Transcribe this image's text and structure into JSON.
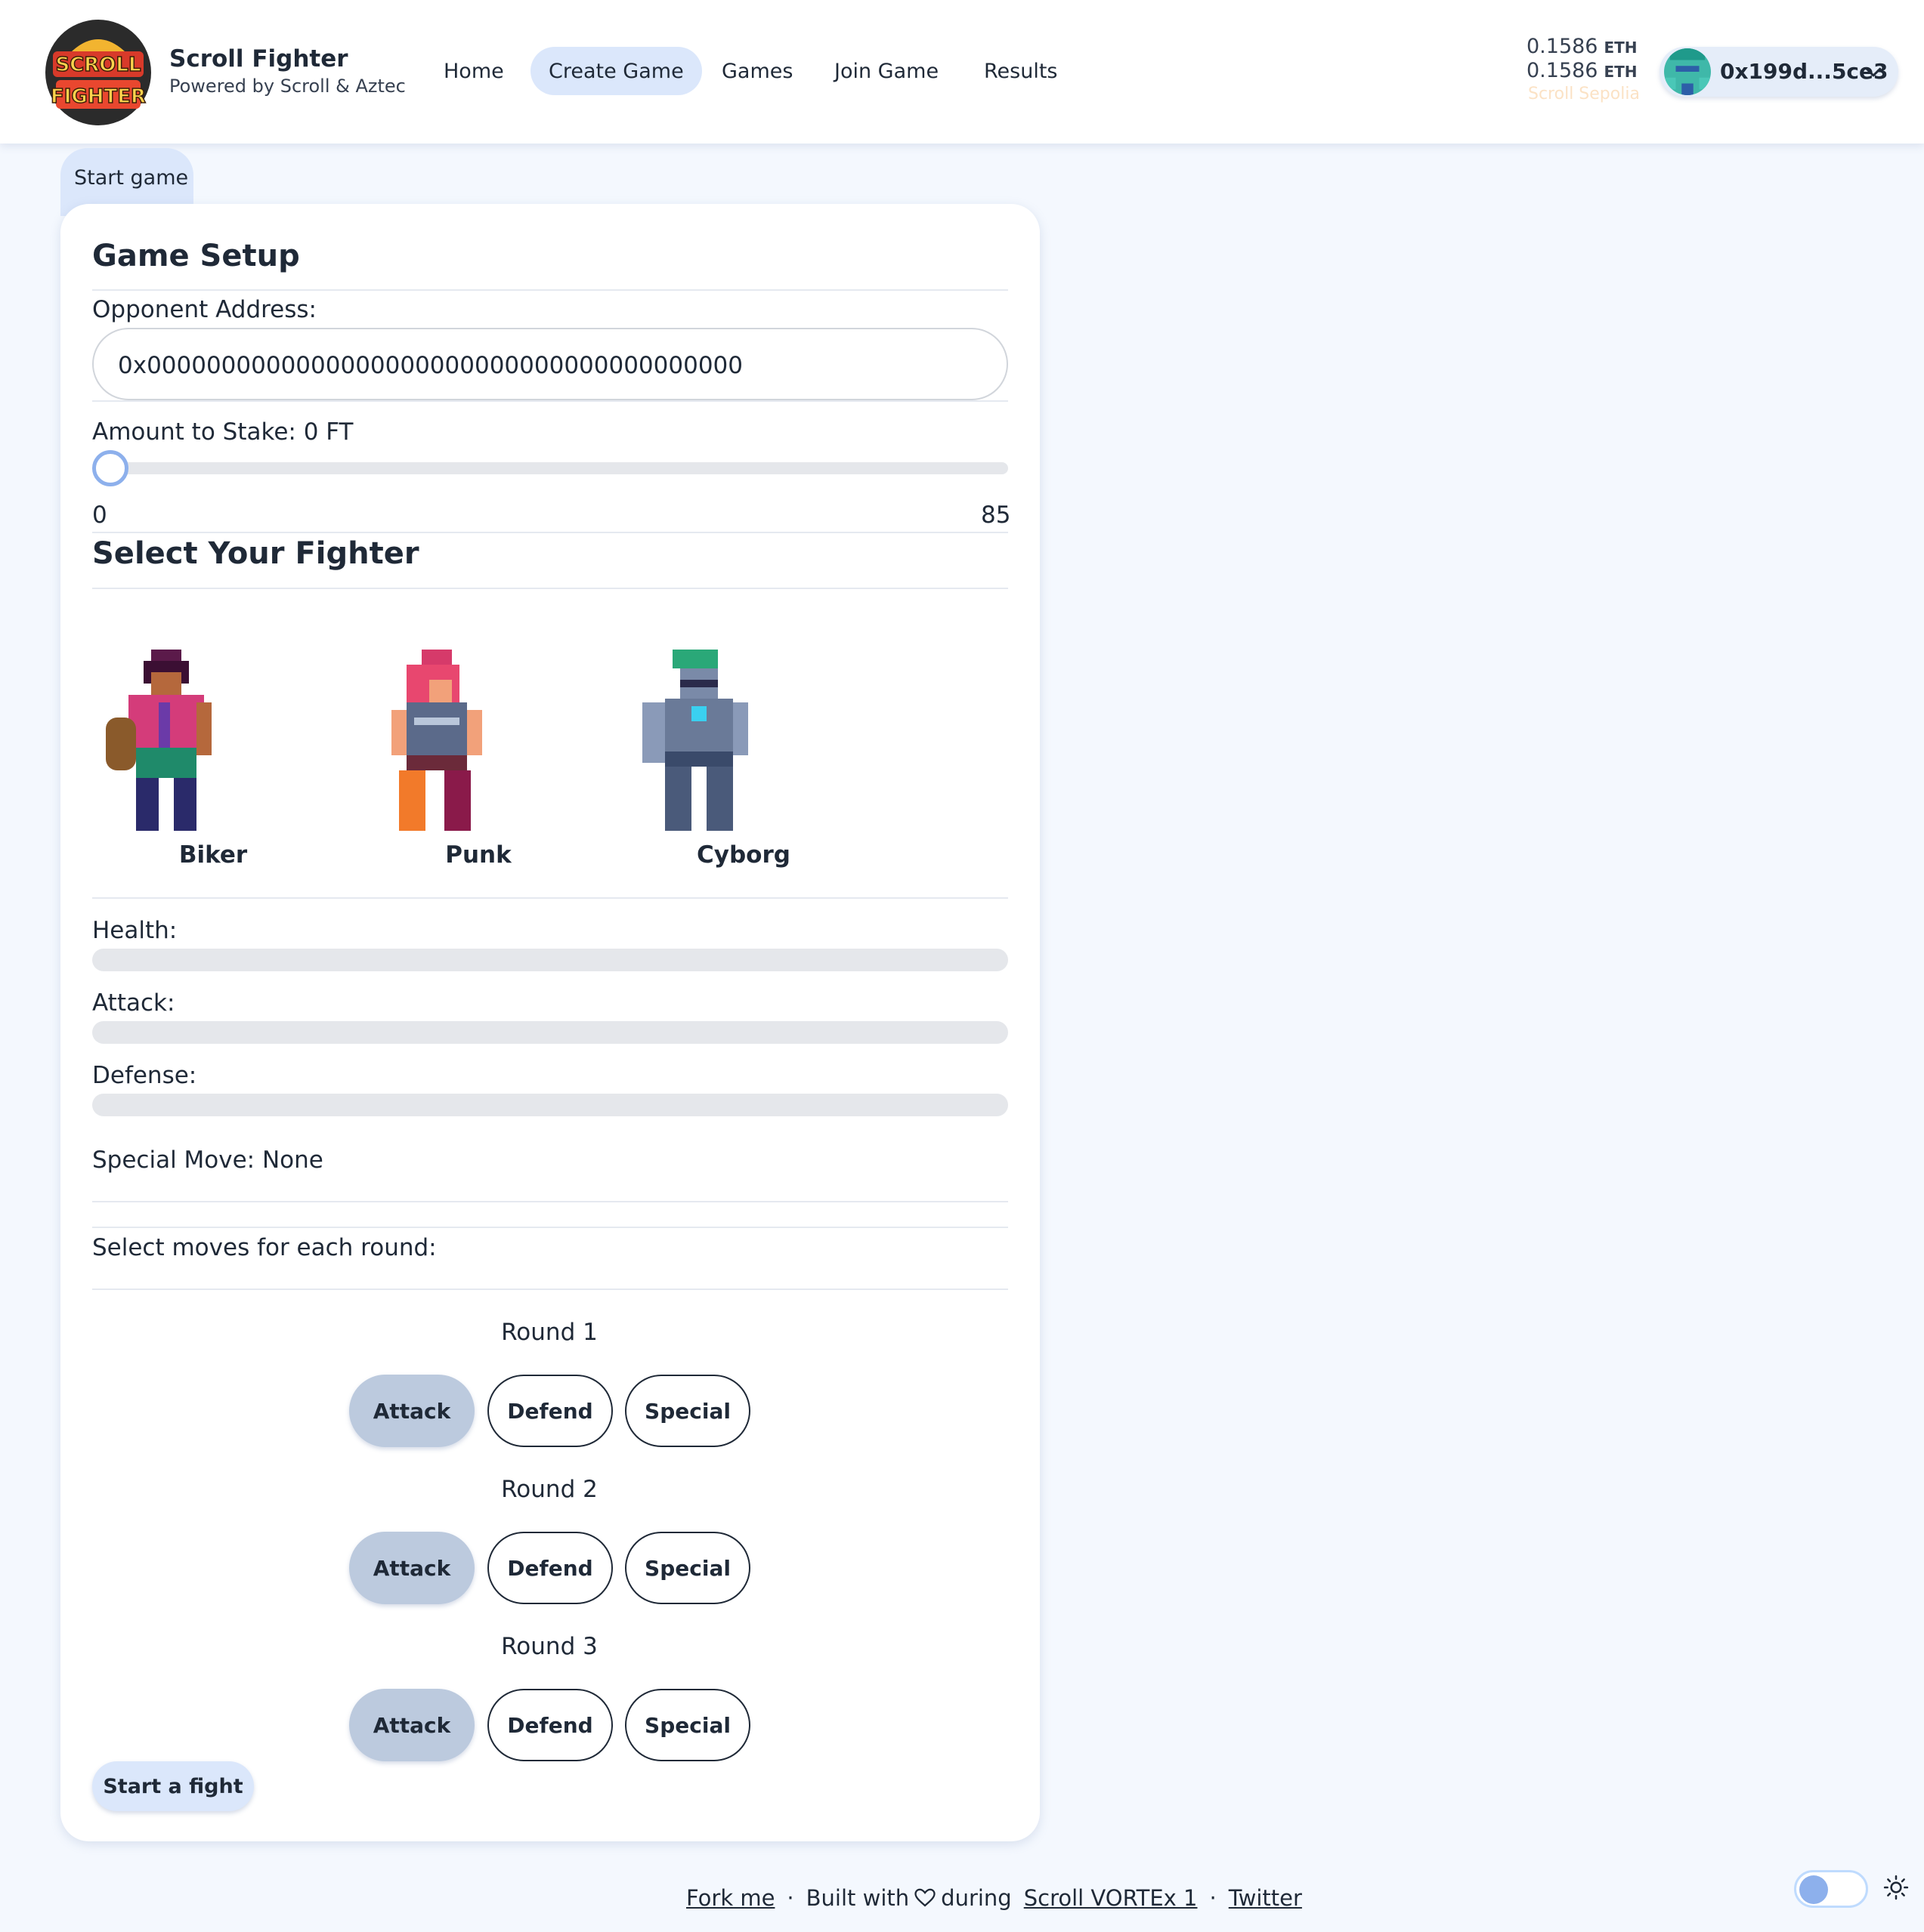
{
  "brand": {
    "title": "Scroll Fighter",
    "subtitle": "Powered by Scroll & Aztec",
    "logo_text": "SCROLL FIGHTER"
  },
  "nav": {
    "home": "Home",
    "create": "Create Game",
    "games": "Games",
    "join": "Join Game",
    "results": "Results",
    "active": "Create Game"
  },
  "wallet": {
    "balance1": "0.1586",
    "balance2": "0.1586",
    "unit": "ETH",
    "network": "Scroll Sepolia",
    "address": "0x199d...5ce3"
  },
  "tab": {
    "label": "Start game"
  },
  "setup": {
    "title": "Game Setup",
    "opponent_label": "Opponent Address:",
    "opponent_value": "0x0000000000000000000000000000000000000000",
    "stake_label": "Amount to Stake: 0 FT",
    "stake_value": 0,
    "stake_min": "0",
    "stake_max": "85"
  },
  "fighters": {
    "title": "Select Your Fighter",
    "items": [
      {
        "name": "Biker"
      },
      {
        "name": "Punk"
      },
      {
        "name": "Cyborg"
      }
    ]
  },
  "stats": {
    "health_label": "Health:",
    "health_value": 0,
    "attack_label": "Attack:",
    "attack_value": 0,
    "defense_label": "Defense:",
    "defense_value": 0,
    "special_move": "Special Move: None"
  },
  "moves": {
    "instruction": "Select moves for each round:",
    "rounds": [
      {
        "label": "Round 1",
        "selected": "Attack"
      },
      {
        "label": "Round 2",
        "selected": "Attack"
      },
      {
        "label": "Round 3",
        "selected": "Attack"
      }
    ],
    "options": [
      "Attack",
      "Defend",
      "Special"
    ]
  },
  "actions": {
    "start": "Start a fight"
  },
  "footer": {
    "fork": "Fork me",
    "built": "Built with",
    "during": "during",
    "event": "Scroll VORTEx 1",
    "twitter": "Twitter",
    "sep": "·"
  },
  "colors": {
    "accent": "#8db0ec",
    "selected": "#bccade",
    "nav_active": "#dbe7fb"
  }
}
